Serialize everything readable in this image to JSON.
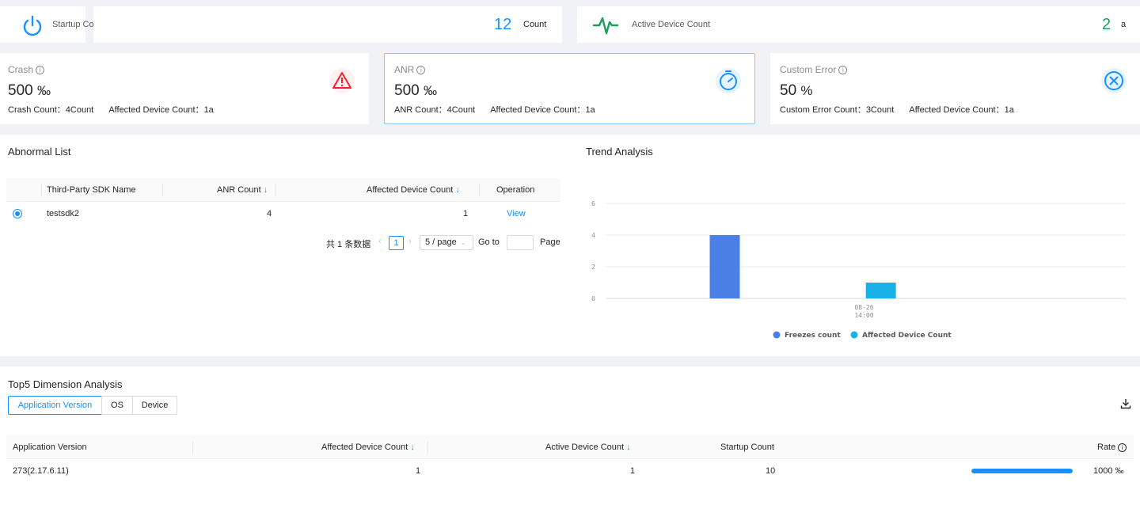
{
  "summary": {
    "startup": {
      "label": "Startup Count",
      "value": "12",
      "unit": "Count"
    },
    "active": {
      "label": "Active Device Count",
      "value": "2",
      "unit": "a"
    }
  },
  "metrics": [
    {
      "title": "Crash",
      "value": "500",
      "unit": "‰",
      "count_label": "Crash Count：",
      "count_value": "4Count",
      "affected_label": "Affected Device Count：",
      "affected_value": "1a",
      "icon": "warning-icon",
      "color": "#f5222d"
    },
    {
      "title": "ANR",
      "value": "500",
      "unit": "‰",
      "count_label": "ANR Count：",
      "count_value": "4Count",
      "affected_label": "Affected Device Count：",
      "affected_value": "1a",
      "icon": "timer-icon",
      "color": "#1890ff"
    },
    {
      "title": "Custom Error",
      "value": "50",
      "unit": "%",
      "count_label": "Custom Error Count：",
      "count_value": "3Count",
      "affected_label": "Affected Device Count：",
      "affected_value": "1a",
      "icon": "close-circle-icon",
      "color": "#1890ff"
    }
  ],
  "abnormal": {
    "title": "Abnormal List",
    "columns": [
      "Third-Party SDK Name",
      "ANR Count",
      "Affected Device Count",
      "Operation"
    ],
    "rows": [
      {
        "name": "testsdk2",
        "anr": "4",
        "affected": "1",
        "op": "View"
      }
    ],
    "pagination": {
      "total": "共 1 条数据",
      "page": "1",
      "page_size": "5 / page",
      "goto": "Go to",
      "page_word": "Page"
    }
  },
  "trend": {
    "title": "Trend Analysis"
  },
  "chart_data": {
    "type": "bar",
    "categories": [
      "08-26\n14:00"
    ],
    "series": [
      {
        "name": "Freezes count",
        "values": [
          4
        ],
        "color": "#4a7fe6"
      },
      {
        "name": "Affected Device Count",
        "values": [
          1
        ],
        "color": "#1ab0e8"
      }
    ],
    "ylim": [
      0,
      6
    ],
    "yticks": [
      0,
      2,
      4,
      6
    ],
    "legend": "bottom",
    "grid": true
  },
  "top5": {
    "title": "Top5 Dimension Analysis",
    "tabs": [
      "Application Version",
      "OS",
      "Device"
    ],
    "columns": [
      "Application Version",
      "Affected Device Count",
      "Active Device Count",
      "Startup Count",
      "Rate"
    ],
    "rows": [
      {
        "version": "273(2.17.6.11)",
        "affected": "1",
        "active": "1",
        "startup": "10",
        "rate": "1000 ‰",
        "rate_fraction": 1.0
      }
    ]
  }
}
